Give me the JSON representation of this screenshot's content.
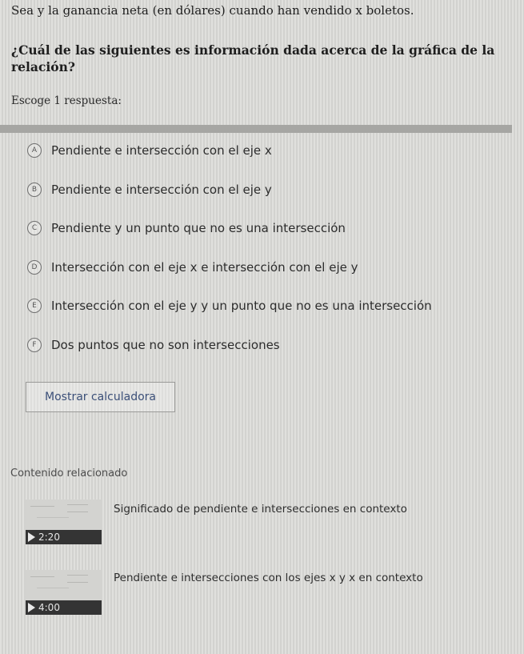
{
  "intro_text": "Sea y la ganancia neta (en dólares) cuando han vendido x boletos.",
  "question": "¿Cuál de las siguientes es información dada acerca de la gráfica de la relación?",
  "instructions": "Escoge 1 respuesta:",
  "options": [
    {
      "letter": "A",
      "text": "Pendiente e intersección con el eje x"
    },
    {
      "letter": "B",
      "text": "Pendiente e intersección con el eje y"
    },
    {
      "letter": "C",
      "text": "Pendiente y un punto que no es una intersección"
    },
    {
      "letter": "D",
      "text": "Intersección con el eje x e intersección con el eje y"
    },
    {
      "letter": "E",
      "text": "Intersección con el eje y y un punto que no es una intersección"
    },
    {
      "letter": "F",
      "text": "Dos puntos que no son intersecciones"
    }
  ],
  "calculator_button": "Mostrar calculadora",
  "related": {
    "title": "Contenido relacionado",
    "videos": [
      {
        "title": "Significado de pendiente e intersecciones en contexto",
        "duration": "2:20"
      },
      {
        "title": "Pendiente e intersecciones con los ejes x y x en contexto",
        "duration": "4:00"
      }
    ]
  },
  "colors": {
    "background": "#d9d9d6",
    "link_blue": "#3b4f78",
    "divider": "#a6a6a3",
    "play_bar": "#343434"
  }
}
